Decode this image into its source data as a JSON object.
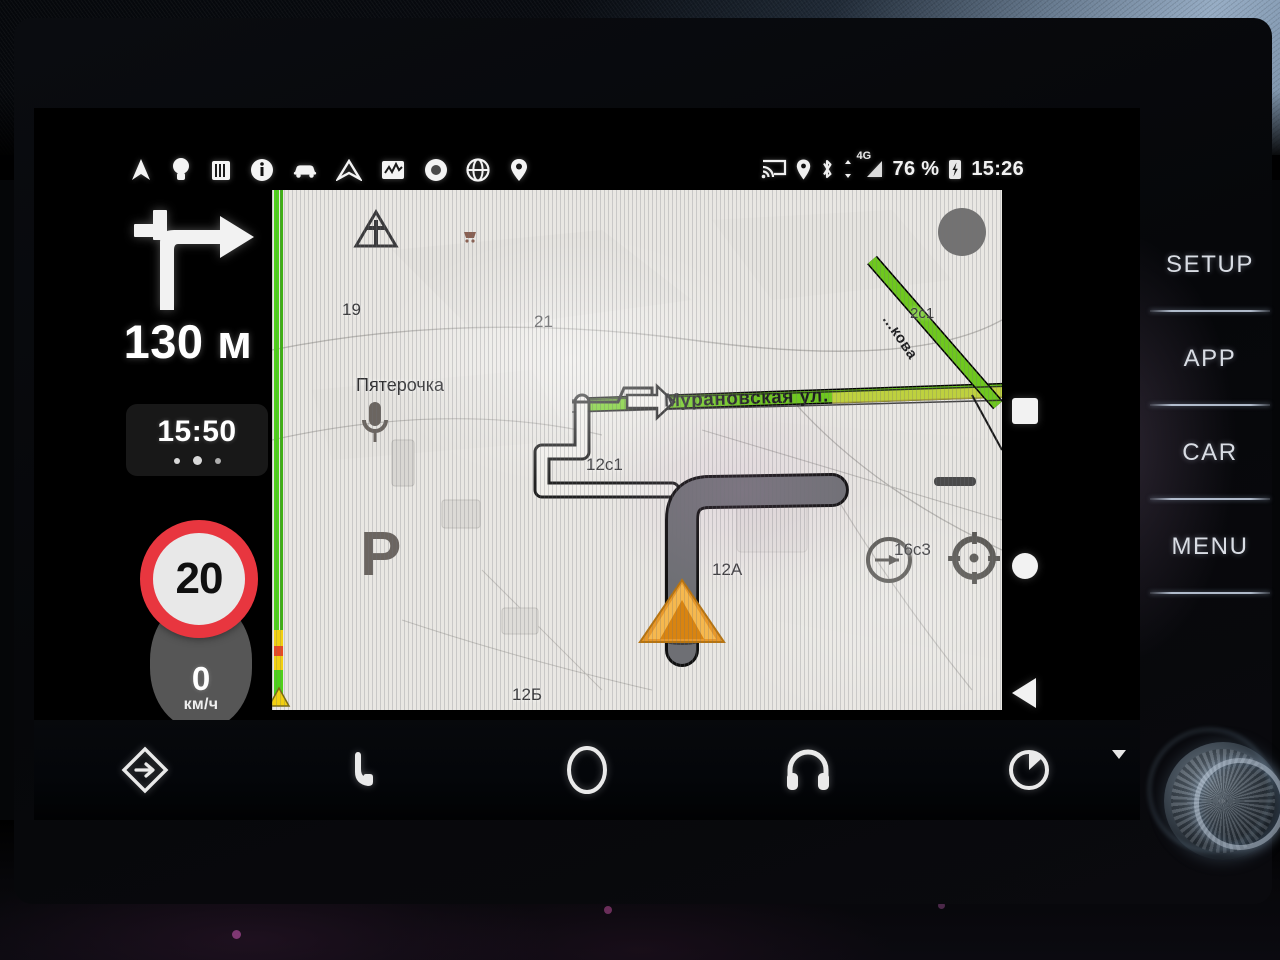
{
  "device": {
    "type": "car-infotainment-head-unit",
    "os_style": "Android Auto navigation"
  },
  "toolbar": {
    "icons": [
      {
        "name": "navigation-arrow-icon",
        "label": "Navigation"
      },
      {
        "name": "lightbulb-icon",
        "label": "Ideas"
      },
      {
        "name": "calendar-icon",
        "label": "Calendar"
      },
      {
        "name": "info-icon",
        "label": "Info"
      },
      {
        "name": "car-icon",
        "label": "Car"
      },
      {
        "name": "compass-arrow-icon",
        "label": "Compass"
      },
      {
        "name": "chart-icon",
        "label": "Statistics"
      },
      {
        "name": "disc-icon",
        "label": "Media"
      },
      {
        "name": "globe-icon",
        "label": "Browser"
      },
      {
        "name": "map-pin-icon",
        "label": "Places"
      }
    ]
  },
  "status_bar": {
    "cast_icon": "cast-icon",
    "location_icon": "location-pin-icon",
    "bluetooth_icon": "bluetooth-icon",
    "signal_icon": "cellular-signal-icon",
    "network_generation": "4G",
    "battery_percent": "76 %",
    "battery_icon": "battery-charging-icon",
    "clock": "15:26"
  },
  "guidance": {
    "maneuver_icon": "turn-right-arrow-icon",
    "distance": "130 м",
    "eta": {
      "time": "15:50",
      "dots": 3
    },
    "speed_limit": "20",
    "current_speed": "0",
    "speed_unit": "км/ч"
  },
  "map": {
    "street_labels": [
      {
        "text": "Мурановская ул.",
        "type": "primary-street"
      },
      {
        "text": "...кова",
        "type": "secondary-street"
      }
    ],
    "building_labels": [
      "19",
      "21",
      "2с1",
      "12с1",
      "12А",
      "16с3",
      "12Б"
    ],
    "poi": {
      "name": "Пятерочка",
      "icon": "shopping-cart-icon",
      "marker": "warning-triangle-icon"
    },
    "buttons": [
      {
        "name": "voice-search-button",
        "icon": "microphone-icon"
      },
      {
        "name": "parking-layer-button",
        "icon": "parking-p-icon"
      },
      {
        "name": "compass-button",
        "icon": "compass-icon"
      },
      {
        "name": "recenter-button",
        "icon": "crosshair-icon"
      }
    ],
    "traffic_bar": {
      "name": "traffic-jam-bar",
      "status_color": "#4ed119"
    },
    "vehicle_marker": {
      "name": "vehicle-position-marker",
      "color": "#f0a030"
    },
    "route_color": "#6e6f74"
  },
  "side_controls": [
    {
      "name": "stop-square-button",
      "shape": "square"
    },
    {
      "name": "record-circle-button",
      "shape": "circle"
    },
    {
      "name": "back-triangle-button",
      "shape": "triangle-left"
    }
  ],
  "bottom_bar": {
    "buttons": [
      {
        "name": "navigation-button",
        "icon": "nav-diamond-icon"
      },
      {
        "name": "phone-button",
        "icon": "phone-icon"
      },
      {
        "name": "home-button",
        "icon": "home-circle-icon"
      },
      {
        "name": "media-button",
        "icon": "headphones-icon"
      },
      {
        "name": "volume-button",
        "icon": "volume-dial-icon"
      }
    ]
  },
  "hardware_menu": {
    "items": [
      {
        "label": "SETUP",
        "name": "hw-setup"
      },
      {
        "label": "APP",
        "name": "hw-app"
      },
      {
        "label": "CAR",
        "name": "hw-car"
      },
      {
        "label": "MENU",
        "name": "hw-menu"
      }
    ]
  },
  "colors": {
    "accent_green": "#4ed119",
    "speed_limit_red": "#e8363f",
    "vehicle_orange": "#f0a030",
    "screen_black": "#000000",
    "map_background": "#e9e7e3"
  }
}
